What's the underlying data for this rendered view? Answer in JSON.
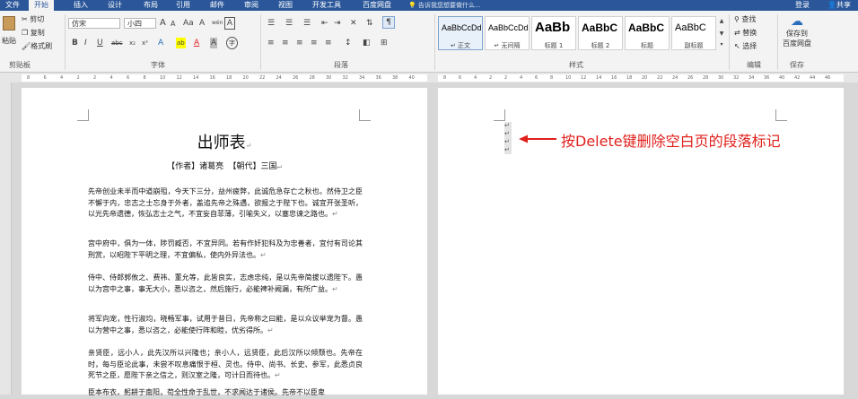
{
  "tabs": [
    "文件",
    "开始",
    "插入",
    "设计",
    "布局",
    "引用",
    "邮件",
    "审阅",
    "视图",
    "开发工具",
    "百度网盘"
  ],
  "tell_me": "告诉我您想要做什么...",
  "login": "登录",
  "share": "共享",
  "clipboard": {
    "paste": "粘贴",
    "cut": "剪切",
    "copy": "复制",
    "painter": "格式刷",
    "label": "剪贴板"
  },
  "font": {
    "name": "仿宋",
    "size": "小四",
    "label": "字体",
    "grow": "A",
    "shrink": "A",
    "aa": "Aa",
    "clear": "A",
    "wen": "wén",
    "border": "A",
    "bold": "B",
    "italic": "I",
    "underline": "U",
    "strike": "abc",
    "sub": "x₂",
    "sup": "x²",
    "effects": "A",
    "highlight": "ab",
    "color": "A",
    "shade": "A",
    "enclose": "字"
  },
  "paragraph": {
    "label": "段落"
  },
  "styles": {
    "label": "样式",
    "items": [
      {
        "sample": "AaBbCcDd",
        "name": "↵ 正文"
      },
      {
        "sample": "AaBbCcDd",
        "name": "↵ 无间隔"
      },
      {
        "sample": "AaBb",
        "name": "标题 1"
      },
      {
        "sample": "AaBbC",
        "name": "标题 2"
      },
      {
        "sample": "AaBbC",
        "name": "标题"
      },
      {
        "sample": "AaBbC",
        "name": "副标题"
      }
    ]
  },
  "editing": {
    "find": "查找",
    "replace": "替换",
    "select": "选择",
    "label": "编辑"
  },
  "save": {
    "line1": "保存到",
    "line2": "百度网盘",
    "label": "保存"
  },
  "ruler_left": [
    "8",
    "6",
    "4",
    "2",
    "2",
    "4",
    "6",
    "8",
    "10",
    "12",
    "14",
    "16",
    "18",
    "20",
    "22",
    "24",
    "26",
    "28",
    "30",
    "32",
    "34",
    "36",
    "38",
    "40"
  ],
  "ruler_right": [
    "8",
    "6",
    "4",
    "2",
    "2",
    "4",
    "6",
    "8",
    "10",
    "12",
    "14",
    "16",
    "18",
    "20",
    "22",
    "24",
    "26",
    "28",
    "30",
    "32",
    "34",
    "36",
    "40",
    "42",
    "44",
    "46"
  ],
  "doc": {
    "title": "出师表",
    "author": "【作者】诸葛亮  【朝代】三国",
    "paragraphs": [
      "先帝创业未半而中道崩殂，今天下三分，益州疲弊，此诚危急存亡之秋也。然侍卫之臣不懈于内，忠志之士忘身于外者，盖追先帝之殊遇，欲报之于陛下也。诚宜开张圣听，以光先帝遗德，恢弘志士之气，不宜妄自菲薄，引喻失义，以塞忠谏之路也。",
      "宫中府中，俱为一体，陟罚臧否，不宜异同。若有作奸犯科及为忠善者，宜付有司论其刑赏，以昭陛下平明之理，不宜偏私，使内外异法也。",
      "侍中、侍郎郭攸之、费祎、董允等，此皆良实，志虑忠纯，是以先帝简拔以遗陛下。愚以为宫中之事，事无大小，悉以咨之，然后施行，必能裨补阙漏，有所广益。",
      "将军向宠，性行淑均，晓畅军事，试用于昔日，先帝称之曰能，是以众议举宠为督。愚以为营中之事，悉以咨之，必能使行阵和睦，优劣得所。",
      "亲贤臣，远小人，此先汉所以兴隆也；亲小人，远贤臣，此后汉所以倾颓也。先帝在时，每与臣论此事，未尝不叹息痛恨于桓、灵也。侍中、尚书、长史、参军，此悉贞良死节之臣，愿陛下亲之信之，则汉室之隆，可计日而待也。",
      "臣本布衣，躬耕于南阳，苟全性命于乱世，不求闻达于诸侯。先帝不以臣卑"
    ]
  },
  "annotation": "按Delete键删除空白页的段落标记",
  "marks": [
    "↵",
    "↵",
    "↵",
    "↵"
  ],
  "colors": {
    "accent": "#2b579a",
    "annotation": "#e0201c"
  }
}
